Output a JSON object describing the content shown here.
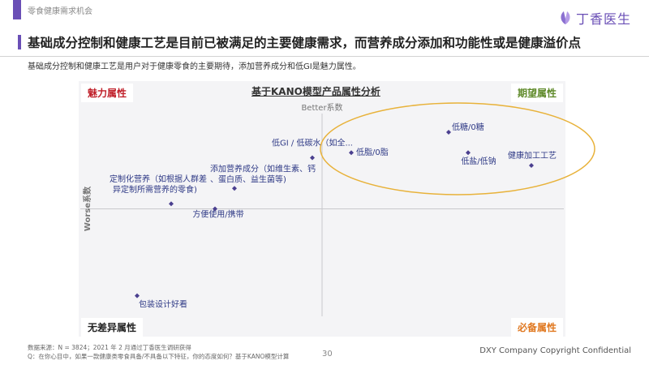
{
  "header": {
    "section_label": "零食健康需求机会",
    "brand_name": "丁香医生",
    "headline": "基础成分控制和健康工艺是目前已被满足的主要健康需求，而营养成分添加和功能性或是健康溢价点",
    "subline": "基础成分控制和健康工艺是用户对于健康零食的主要期待，添加营养成分和低GI是魅力属性。"
  },
  "quadrants": {
    "top_left": "魅力属性",
    "top_right": "期望属性",
    "bottom_left": "无差异属性",
    "bottom_right": "必备属性"
  },
  "colors": {
    "brand": "#6a4fb6",
    "attractive": "#c0202a",
    "expected": "#5f8a2a",
    "must_be": "#e07820",
    "indifferent": "#222222",
    "highlight_ellipse": "#e8b23a"
  },
  "chart_data": {
    "type": "scatter",
    "title": "基于KANO模型产品属性分析",
    "xlabel": "Worse系数",
    "ylabel": "Better系数",
    "xlim": [
      0,
      1
    ],
    "ylim": [
      0,
      1
    ],
    "highlight_group": [
      "低脂/0脂",
      "低糖/0糖",
      "低盐/低钠",
      "健康加工工艺"
    ],
    "points": [
      {
        "label": "低GI / 低碳水（如全...",
        "x": 0.48,
        "y": 0.7
      },
      {
        "label": "低脂/0脂",
        "x": 0.56,
        "y": 0.72
      },
      {
        "label": "低糖/0糖",
        "x": 0.76,
        "y": 0.8
      },
      {
        "label": "低盐/低钠",
        "x": 0.8,
        "y": 0.72
      },
      {
        "label": "健康加工工艺",
        "x": 0.93,
        "y": 0.67
      },
      {
        "label": "定制化营养（如根据人群差异定制所需营养的零食)",
        "x": 0.19,
        "y": 0.52
      },
      {
        "label": "添加营养成分（如维生素、钙、蛋白质、益生菌等)",
        "x": 0.32,
        "y": 0.58
      },
      {
        "label": "方便使用/携带",
        "x": 0.28,
        "y": 0.5
      },
      {
        "label": "包装设计好看",
        "x": 0.12,
        "y": 0.16
      }
    ]
  },
  "footer": {
    "source": "数据来源：N = 3824；2021 年 2 月通过丁香医生调研获得",
    "note": "Q：在你心目中，如果一款健康类零食具备/不具备以下特征，你的态度如何？基于KANO模型计算",
    "page_number": "30",
    "copyright": "DXY Company Copyright Confidential"
  }
}
